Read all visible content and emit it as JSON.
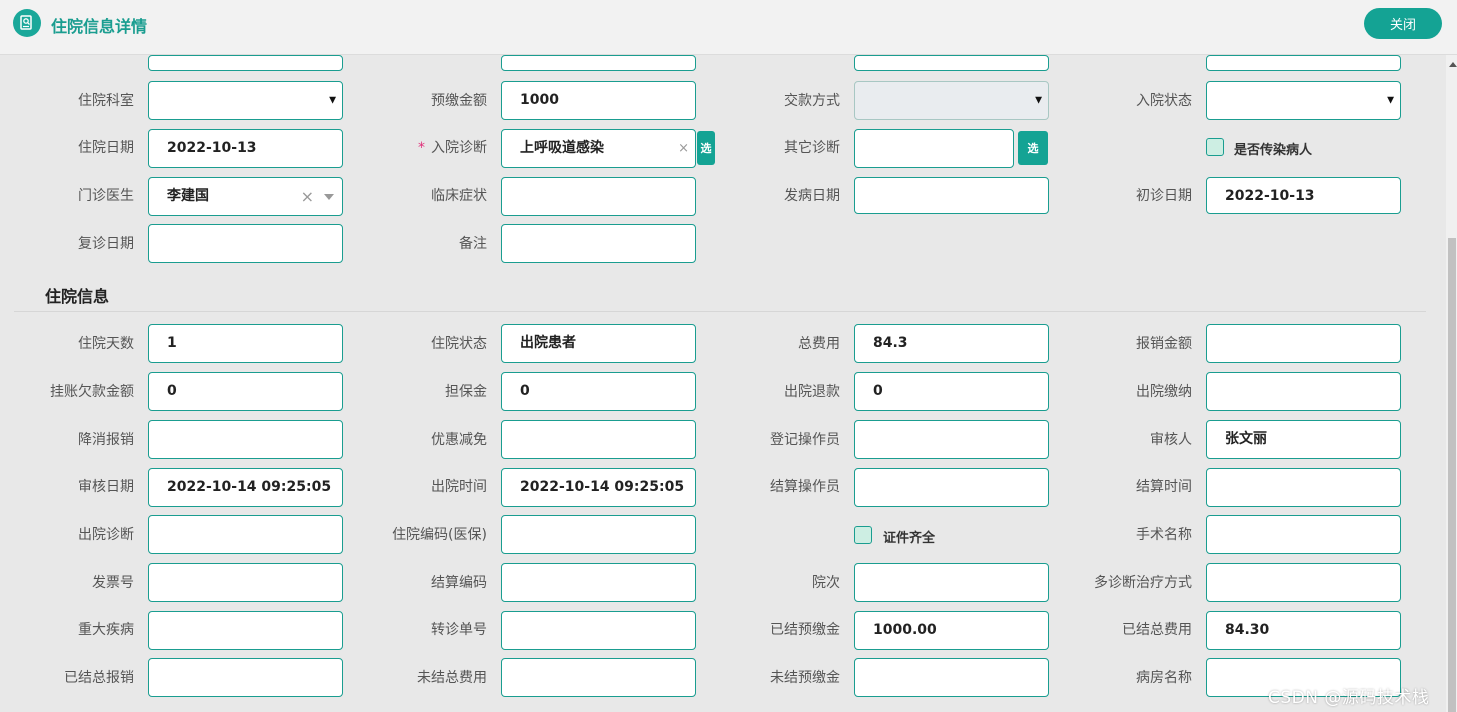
{
  "header": {
    "title": "住院信息详情",
    "close_label": "关闭"
  },
  "top_form": {
    "dept_label": "住院科室",
    "deposit_label": "预缴金额",
    "deposit_value": "1000",
    "payment_method_label": "交款方式",
    "admission_status_label": "入院状态",
    "admission_date_label": "住院日期",
    "admission_date_value": "2022-10-13",
    "admission_diag_required": "*",
    "admission_diag_label": "入院诊断",
    "admission_diag_value": "上呼吸道感染",
    "select_label": "选",
    "other_diag_label": "其它诊断",
    "infectious_label": "是否传染病人",
    "outpatient_doctor_label": "门诊医生",
    "outpatient_doctor_value": "李建国",
    "symptoms_label": "临床症状",
    "onset_date_label": "发病日期",
    "first_visit_label": "初诊日期",
    "first_visit_value": "2022-10-13",
    "revisit_label": "复诊日期",
    "remarks_label": "备注",
    "clipped_value_3": "李建国",
    "clipped_value_4": "张文丽"
  },
  "section": {
    "title": "住院信息"
  },
  "hosp": {
    "days_label": "住院天数",
    "days_value": "1",
    "status_label": "住院状态",
    "status_value": "出院患者",
    "total_fee_label": "总费用",
    "total_fee_value": "84.3",
    "reimburse_label": "报销金额",
    "arrears_label": "挂账欠款金额",
    "arrears_value": "0",
    "guarantee_label": "担保金",
    "guarantee_value": "0",
    "refund_label": "出院退款",
    "refund_value": "0",
    "discharge_pay_label": "出院缴纳",
    "write_off_label": "降消报销",
    "discount_label": "优惠减免",
    "register_op_label": "登记操作员",
    "reviewer_label": "审核人",
    "reviewer_value": "张文丽",
    "review_date_label": "审核日期",
    "review_date_value": "2022-10-14 09:25:05",
    "discharge_time_label": "出院时间",
    "discharge_time_value": "2022-10-14 09:25:05",
    "settle_op_label": "结算操作员",
    "settle_time_label": "结算时间",
    "discharge_diag_label": "出院诊断",
    "insurance_code_label": "住院编码(医保)",
    "docs_complete_label": "证件齐全",
    "surgery_label": "手术名称",
    "invoice_label": "发票号",
    "settle_code_label": "结算编码",
    "visit_count_label": "院次",
    "multi_diag_label": "多诊断治疗方式",
    "major_disease_label": "重大疾病",
    "referral_label": "转诊单号",
    "settled_deposit_label": "已结预缴金",
    "settled_deposit_value": "1000.00",
    "settled_total_label": "已结总费用",
    "settled_total_value": "84.30",
    "settled_reimburse_label": "已结总报销",
    "unsettled_total_label": "未结总费用",
    "unsettled_deposit_label": "未结预缴金",
    "ward_label": "病房名称"
  },
  "watermark": "CSDN @源码技术栈"
}
